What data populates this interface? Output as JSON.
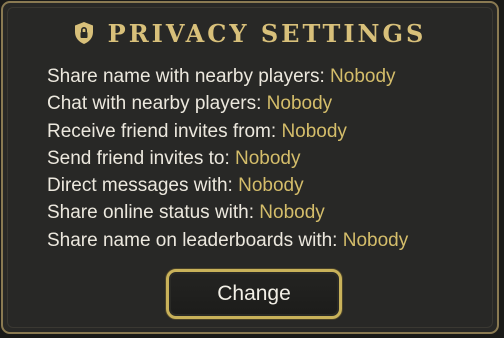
{
  "dialog": {
    "icon": "shield-lock-icon",
    "title": "PRIVACY SETTINGS",
    "settings": [
      {
        "label": "Share name with nearby players:",
        "value": "Nobody"
      },
      {
        "label": "Chat with nearby players:",
        "value": "Nobody"
      },
      {
        "label": "Receive friend invites from:",
        "value": "Nobody"
      },
      {
        "label": "Send friend invites to:",
        "value": "Nobody"
      },
      {
        "label": "Direct messages with:",
        "value": "Nobody"
      },
      {
        "label": "Share online status with:",
        "value": "Nobody"
      },
      {
        "label": "Share name on leaderboards with:",
        "value": "Nobody"
      }
    ],
    "change_button": "Change"
  },
  "colors": {
    "accent_gold": "#d4bd6a",
    "title_gold": "#d8c07a",
    "text": "#ece8de",
    "panel_bg": "#282826",
    "border_gold": "#8a7a52"
  }
}
